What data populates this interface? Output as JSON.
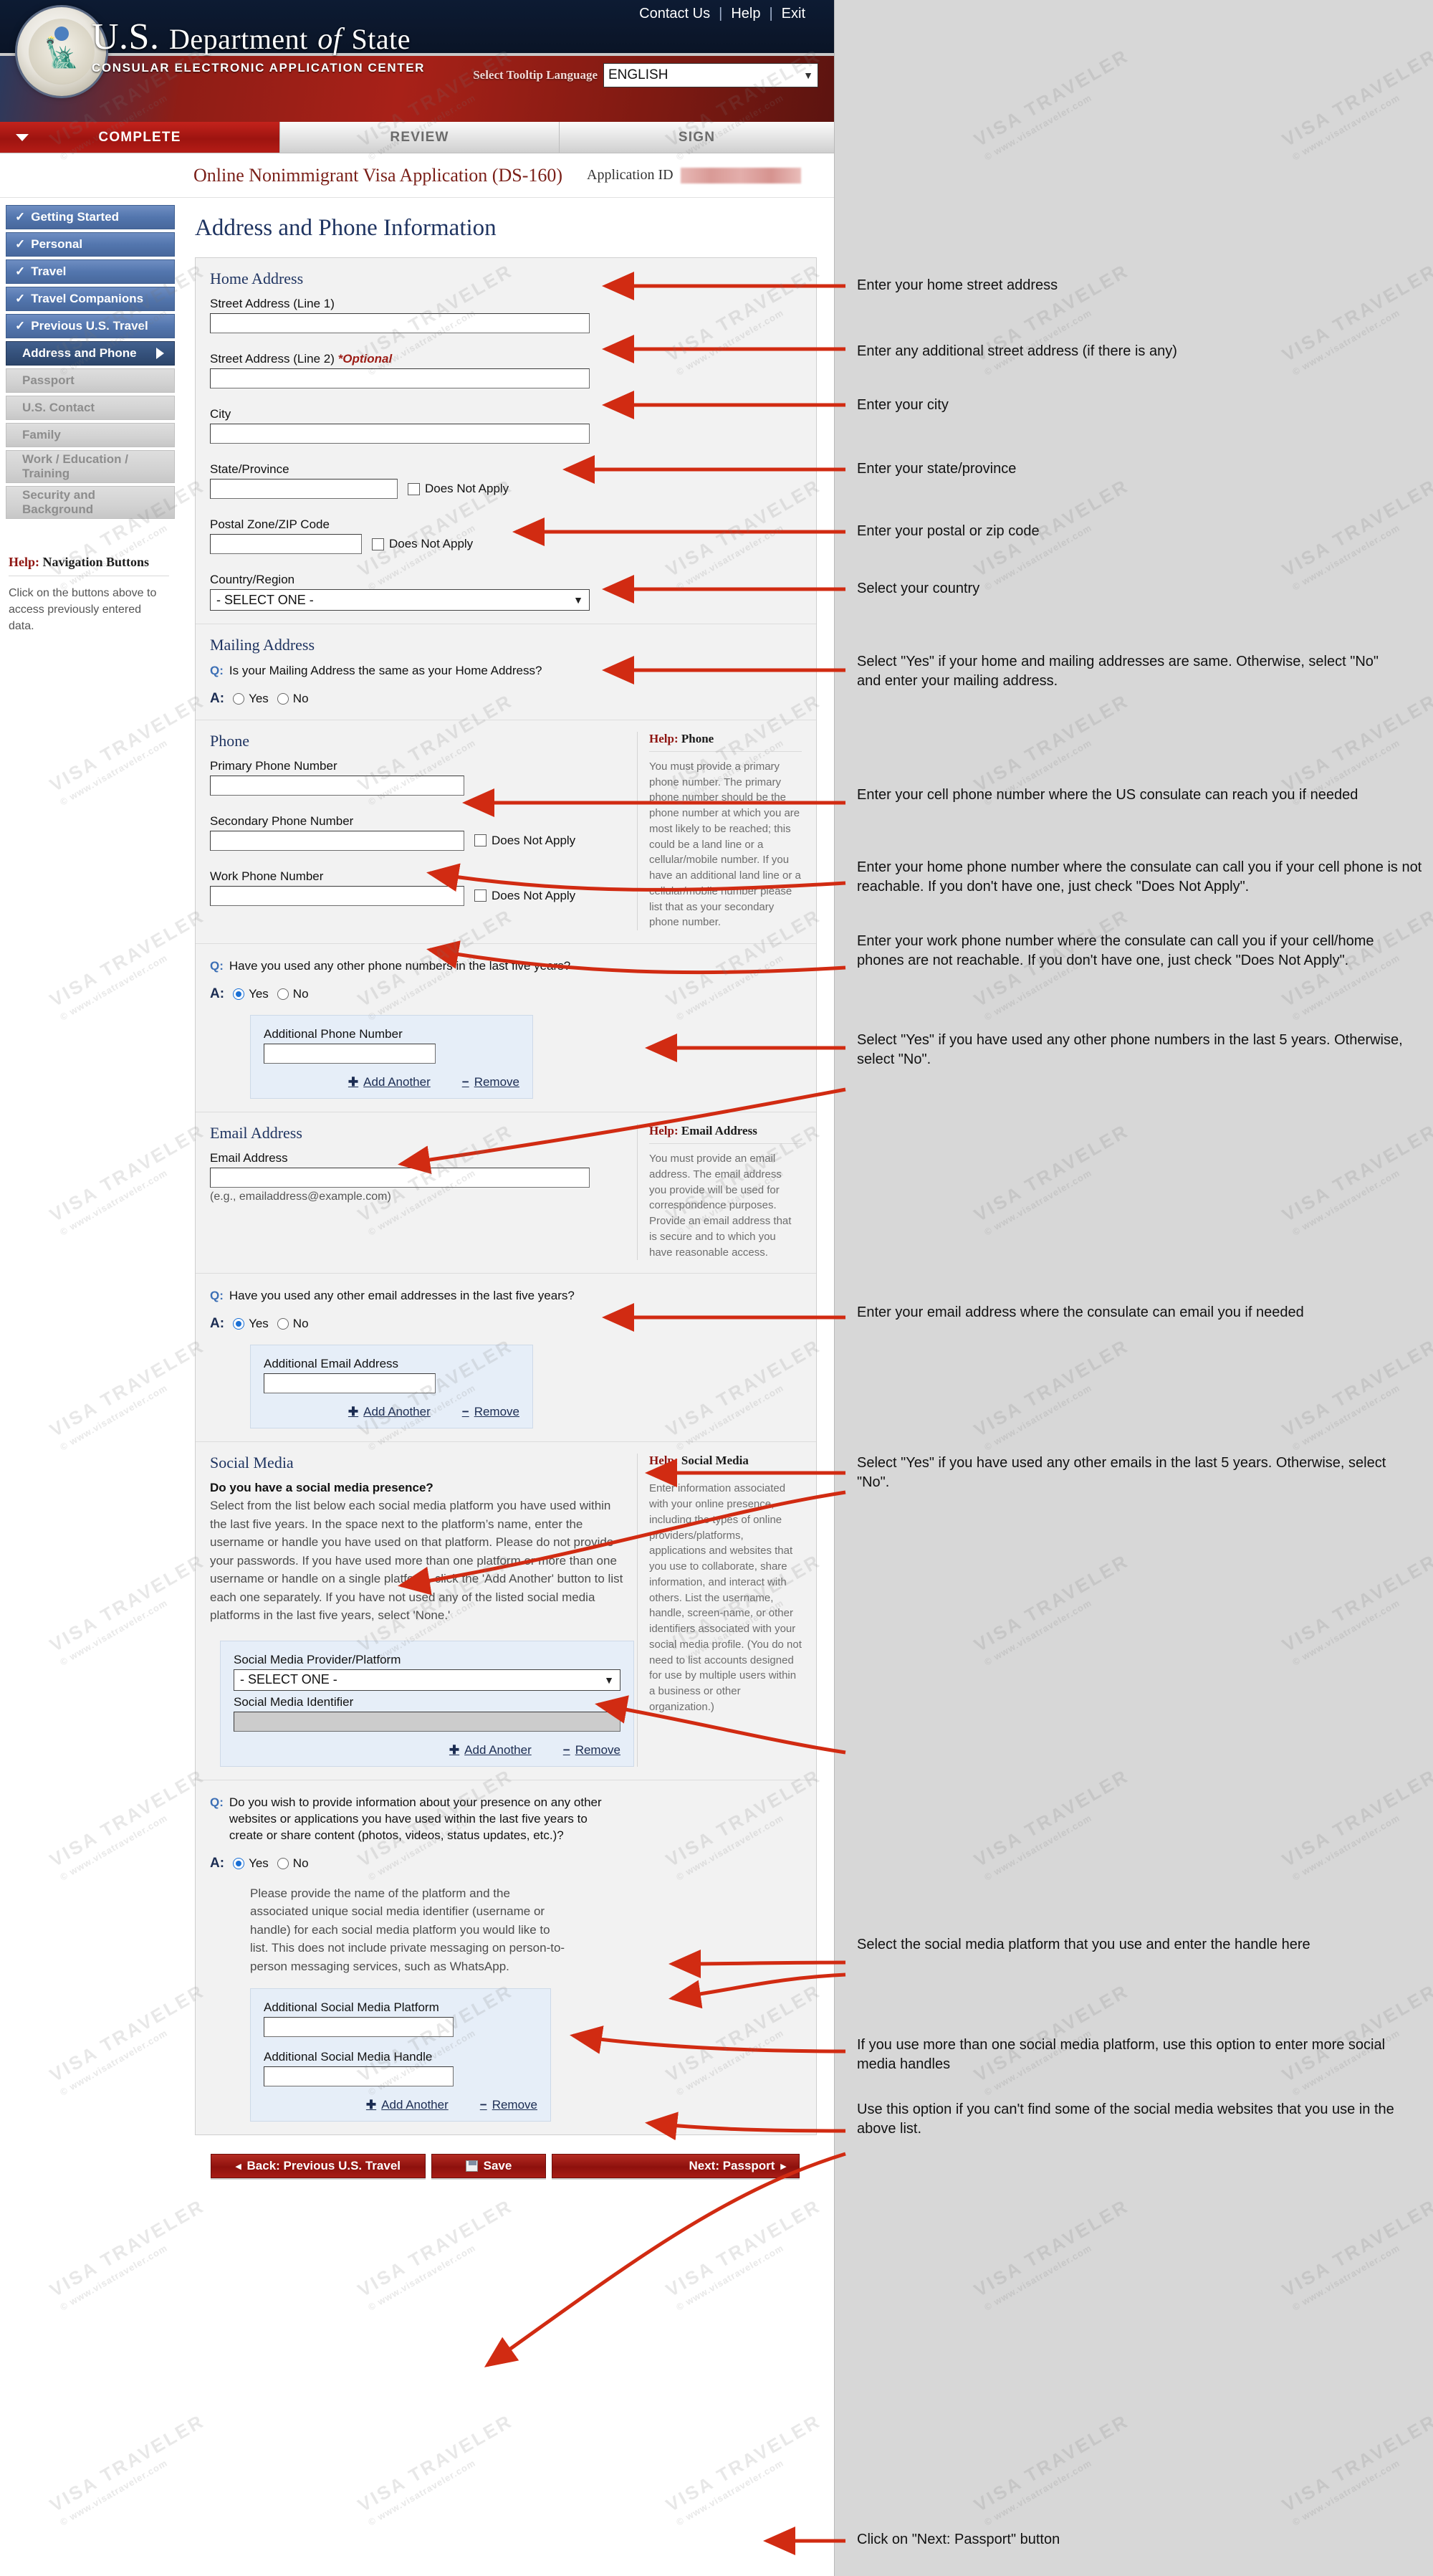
{
  "header": {
    "dept_title_us": "U.S.",
    "dept_title_department": "Department",
    "dept_title_of": "of",
    "dept_title_state": "State",
    "dept_subtitle": "CONSULAR ELECTRONIC APPLICATION CENTER",
    "topnav": [
      "Contact Us",
      "Help",
      "Exit"
    ],
    "tooltip_language_label": "Select Tooltip Language",
    "tooltip_language_value": "ENGLISH"
  },
  "steps": [
    {
      "label": "COMPLETE",
      "state": "active"
    },
    {
      "label": "REVIEW",
      "state": "inactive"
    },
    {
      "label": "SIGN",
      "state": "inactive"
    }
  ],
  "app_bar": {
    "title": "Online Nonimmigrant Visa Application (DS-160)",
    "application_id_label": "Application ID"
  },
  "sidebar": {
    "items": [
      {
        "label": "Getting Started",
        "state": "done"
      },
      {
        "label": "Personal",
        "state": "done"
      },
      {
        "label": "Travel",
        "state": "done"
      },
      {
        "label": "Travel Companions",
        "state": "done"
      },
      {
        "label": "Previous U.S. Travel",
        "state": "done"
      },
      {
        "label": "Address and Phone",
        "state": "current"
      },
      {
        "label": "Passport",
        "state": "disabled"
      },
      {
        "label": "U.S. Contact",
        "state": "disabled"
      },
      {
        "label": "Family",
        "state": "disabled"
      },
      {
        "label": "Work / Education / Training",
        "state": "disabled",
        "line1": "Work / Education /",
        "line2": "Training"
      },
      {
        "label": "Security and Background",
        "state": "disabled",
        "line1": "Security and",
        "line2": "Background"
      }
    ],
    "help": {
      "title_prefix": "Help:",
      "title": "Navigation Buttons",
      "body": "Click on the buttons above to access previously entered data."
    }
  },
  "page": {
    "heading": "Address and Phone Information"
  },
  "home_address": {
    "section_title": "Home Address",
    "street1_label": "Street Address (Line 1)",
    "street1_value": "",
    "street2_label": "Street Address (Line 2)",
    "street2_optional": "*Optional",
    "street2_value": "",
    "city_label": "City",
    "city_value": "",
    "state_label": "State/Province",
    "state_value": "",
    "state_dna_label": "Does Not Apply",
    "postal_label": "Postal Zone/ZIP Code",
    "postal_value": "",
    "postal_dna_label": "Does Not Apply",
    "country_label": "Country/Region",
    "country_value": "- SELECT ONE -"
  },
  "mailing_address": {
    "section_title": "Mailing Address",
    "question": "Is your Mailing Address the same as your Home Address?",
    "q_mark": "Q:",
    "a_mark": "A:",
    "yes": "Yes",
    "no": "No",
    "selected": ""
  },
  "phone": {
    "section_title": "Phone",
    "primary_label": "Primary Phone Number",
    "primary_value": "",
    "secondary_label": "Secondary Phone Number",
    "secondary_value": "",
    "secondary_dna_label": "Does Not Apply",
    "work_label": "Work Phone Number",
    "work_value": "",
    "work_dna_label": "Does Not Apply",
    "help": {
      "title_prefix": "Help:",
      "title": "Phone",
      "body": "You must provide a primary phone number. The primary phone number should be the phone number at which you are most likely to be reached; this could be a land line or a cellular/mobile number. If you have an additional land line or a cellular/mobile number please list that as your secondary phone number."
    },
    "other_numbers_question": "Have you used any other phone numbers in the last five years?",
    "q_mark": "Q:",
    "a_mark": "A:",
    "yes": "Yes",
    "no": "No",
    "selected": "Yes",
    "additional_label": "Additional Phone Number",
    "additional_value": "",
    "add_another": "Add Another",
    "remove": "Remove"
  },
  "email": {
    "section_title": "Email Address",
    "field_label": "Email Address",
    "field_value": "",
    "example": "(e.g., emailaddress@example.com)",
    "help": {
      "title_prefix": "Help:",
      "title": "Email Address",
      "body": "You must provide an email address. The email address you provide will be used for correspondence purposes. Provide an email address that is secure and to which you have reasonable access."
    },
    "other_emails_question": "Have you used any other email addresses in the last five years?",
    "q_mark": "Q:",
    "a_mark": "A:",
    "yes": "Yes",
    "no": "No",
    "selected": "Yes",
    "additional_label": "Additional Email Address",
    "additional_value": "",
    "add_another": "Add Another",
    "remove": "Remove"
  },
  "social_media": {
    "section_title": "Social Media",
    "presence_question": "Do you have a social media presence?",
    "instructions": "Select from the list below each social media platform you have used within the last five years. In the space next to the platform’s name, enter the username or handle you have used on that platform. Please do not provide your passwords. If you have used more than one platform or more than one username or handle on a single platform, click the 'Add Another' button to list each one separately. If you have not used any of the listed social media platforms in the last five years, select 'None.'",
    "help": {
      "title_prefix": "Help:",
      "title": "Social Media",
      "body": "Enter information associated with your online presence, including the types of online providers/platforms, applications and websites that you use to collaborate, share information, and interact with others. List the username, handle, screen-name, or other identifiers associated with your social media profile. (You do not need to list accounts designed for use by multiple users within a business or other organization.)"
    },
    "provider_label": "Social Media Provider/Platform",
    "provider_value": "- SELECT ONE -",
    "identifier_label": "Social Media Identifier",
    "identifier_value": "",
    "add_another": "Add Another",
    "remove": "Remove"
  },
  "other_websites": {
    "q_mark": "Q:",
    "a_mark": "A:",
    "question": "Do you wish to provide information about your presence on any other websites or applications you have used within the last five years to create or share content (photos, videos, status updates, etc.)?",
    "yes": "Yes",
    "no": "No",
    "selected": "Yes",
    "instructions": "Please provide the name of the platform and the associated unique social media identifier (username or handle) for each social media platform you would like to list. This does not include private messaging on person-to-person messaging services, such as WhatsApp.",
    "platform_label": "Additional Social Media Platform",
    "platform_value": "",
    "handle_label": "Additional Social Media Handle",
    "handle_value": "",
    "add_another": "Add Another",
    "remove": "Remove"
  },
  "footer_buttons": {
    "back": "Back: Previous U.S. Travel",
    "save": "Save",
    "next": "Next: Passport",
    "back_arrow": "◂",
    "next_arrow": "▸"
  },
  "annotations": [
    {
      "id": "a1",
      "text": "Enter your home street address"
    },
    {
      "id": "a2",
      "text": "Enter any additional street address (if there is any)"
    },
    {
      "id": "a3",
      "text": "Enter your city"
    },
    {
      "id": "a4",
      "text": "Enter your state/province"
    },
    {
      "id": "a5",
      "text": "Enter your postal or zip code"
    },
    {
      "id": "a6",
      "text": "Select your country"
    },
    {
      "id": "a7",
      "text": "Select \"Yes\" if your home and mailing addresses are same. Otherwise, select \"No\" and enter your mailing address."
    },
    {
      "id": "a8",
      "text": "Enter your cell phone number where the US consulate can reach you if needed"
    },
    {
      "id": "a9",
      "text": "Enter your home phone number where the consulate can call you if your cell phone is not reachable. If you don't have one, just check \"Does Not Apply\"."
    },
    {
      "id": "a10",
      "text": "Enter your work phone number where the consulate can call you if your cell/home phones are not reachable. If you don't have one, just check \"Does Not Apply\"."
    },
    {
      "id": "a11",
      "text": "Select \"Yes\" if you have used any other phone numbers in the last 5 years. Otherwise, select \"No\"."
    },
    {
      "id": "a12",
      "text": "Enter your email address where the consulate can email you if needed"
    },
    {
      "id": "a13",
      "text": "Select \"Yes\" if you have used any other emails in the last 5 years. Otherwise, select \"No\"."
    },
    {
      "id": "a14",
      "text": "Select the social media platform that you use and enter the handle here"
    },
    {
      "id": "a15",
      "text": "If you use more than one social media platform, use this option to enter more social media handles"
    },
    {
      "id": "a16",
      "text": "Use this option if you can't find some of the social media websites that you use in the above list."
    },
    {
      "id": "a17",
      "text": "Click on \"Next: Passport\" button"
    }
  ],
  "watermark": {
    "line1": "VISA TRAVELER",
    "line2": "© www.visatraveler.com"
  },
  "colors": {
    "brand_red": "#a81c15",
    "nav_blue": "#5376ae",
    "heading_navy": "#1f3461",
    "annotation_arrow": "#d12b12"
  }
}
